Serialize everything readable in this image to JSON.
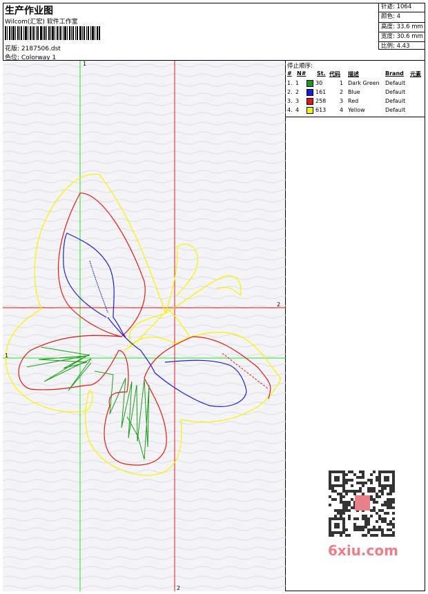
{
  "header": {
    "title": "生产作业图",
    "company": "Wilcom(汇宏) 软件工作室",
    "design_label": "花版:",
    "design_value": "2187506.dst",
    "colorway_label": "色位:",
    "colorway_value": "Colorway 1"
  },
  "stats": {
    "stitches": "针迹: 1064",
    "colors": "颜色: 4",
    "height": "高度: 33.6 mm",
    "width": "宽度: 30.6 mm",
    "scale": "比例: 4.43"
  },
  "stop_sequence": {
    "title": "停止顺序:",
    "columns": [
      "#",
      "N#",
      "St.",
      "代码",
      "描述",
      "Brand",
      "元素"
    ],
    "rows": [
      {
        "idx": "1.",
        "n": "1",
        "color": "#1a9a1a",
        "stitches": "30",
        "code": "1",
        "desc": "Dark Green",
        "brand": "Default"
      },
      {
        "idx": "2.",
        "n": "2",
        "color": "#1c1cd6",
        "stitches": "161",
        "code": "2",
        "desc": "Blue",
        "brand": "Default"
      },
      {
        "idx": "3.",
        "n": "3",
        "color": "#e01818",
        "stitches": "258",
        "code": "3",
        "desc": "Red",
        "brand": "Default"
      },
      {
        "idx": "4.",
        "n": "4",
        "color": "#f4f400",
        "stitches": "613",
        "code": "4",
        "desc": "Yellow",
        "brand": "Default"
      }
    ]
  },
  "axes": {
    "green_v": "1",
    "green_h": "1",
    "red_h": "2",
    "red_v": "2"
  },
  "watermark": "6xiu.com"
}
